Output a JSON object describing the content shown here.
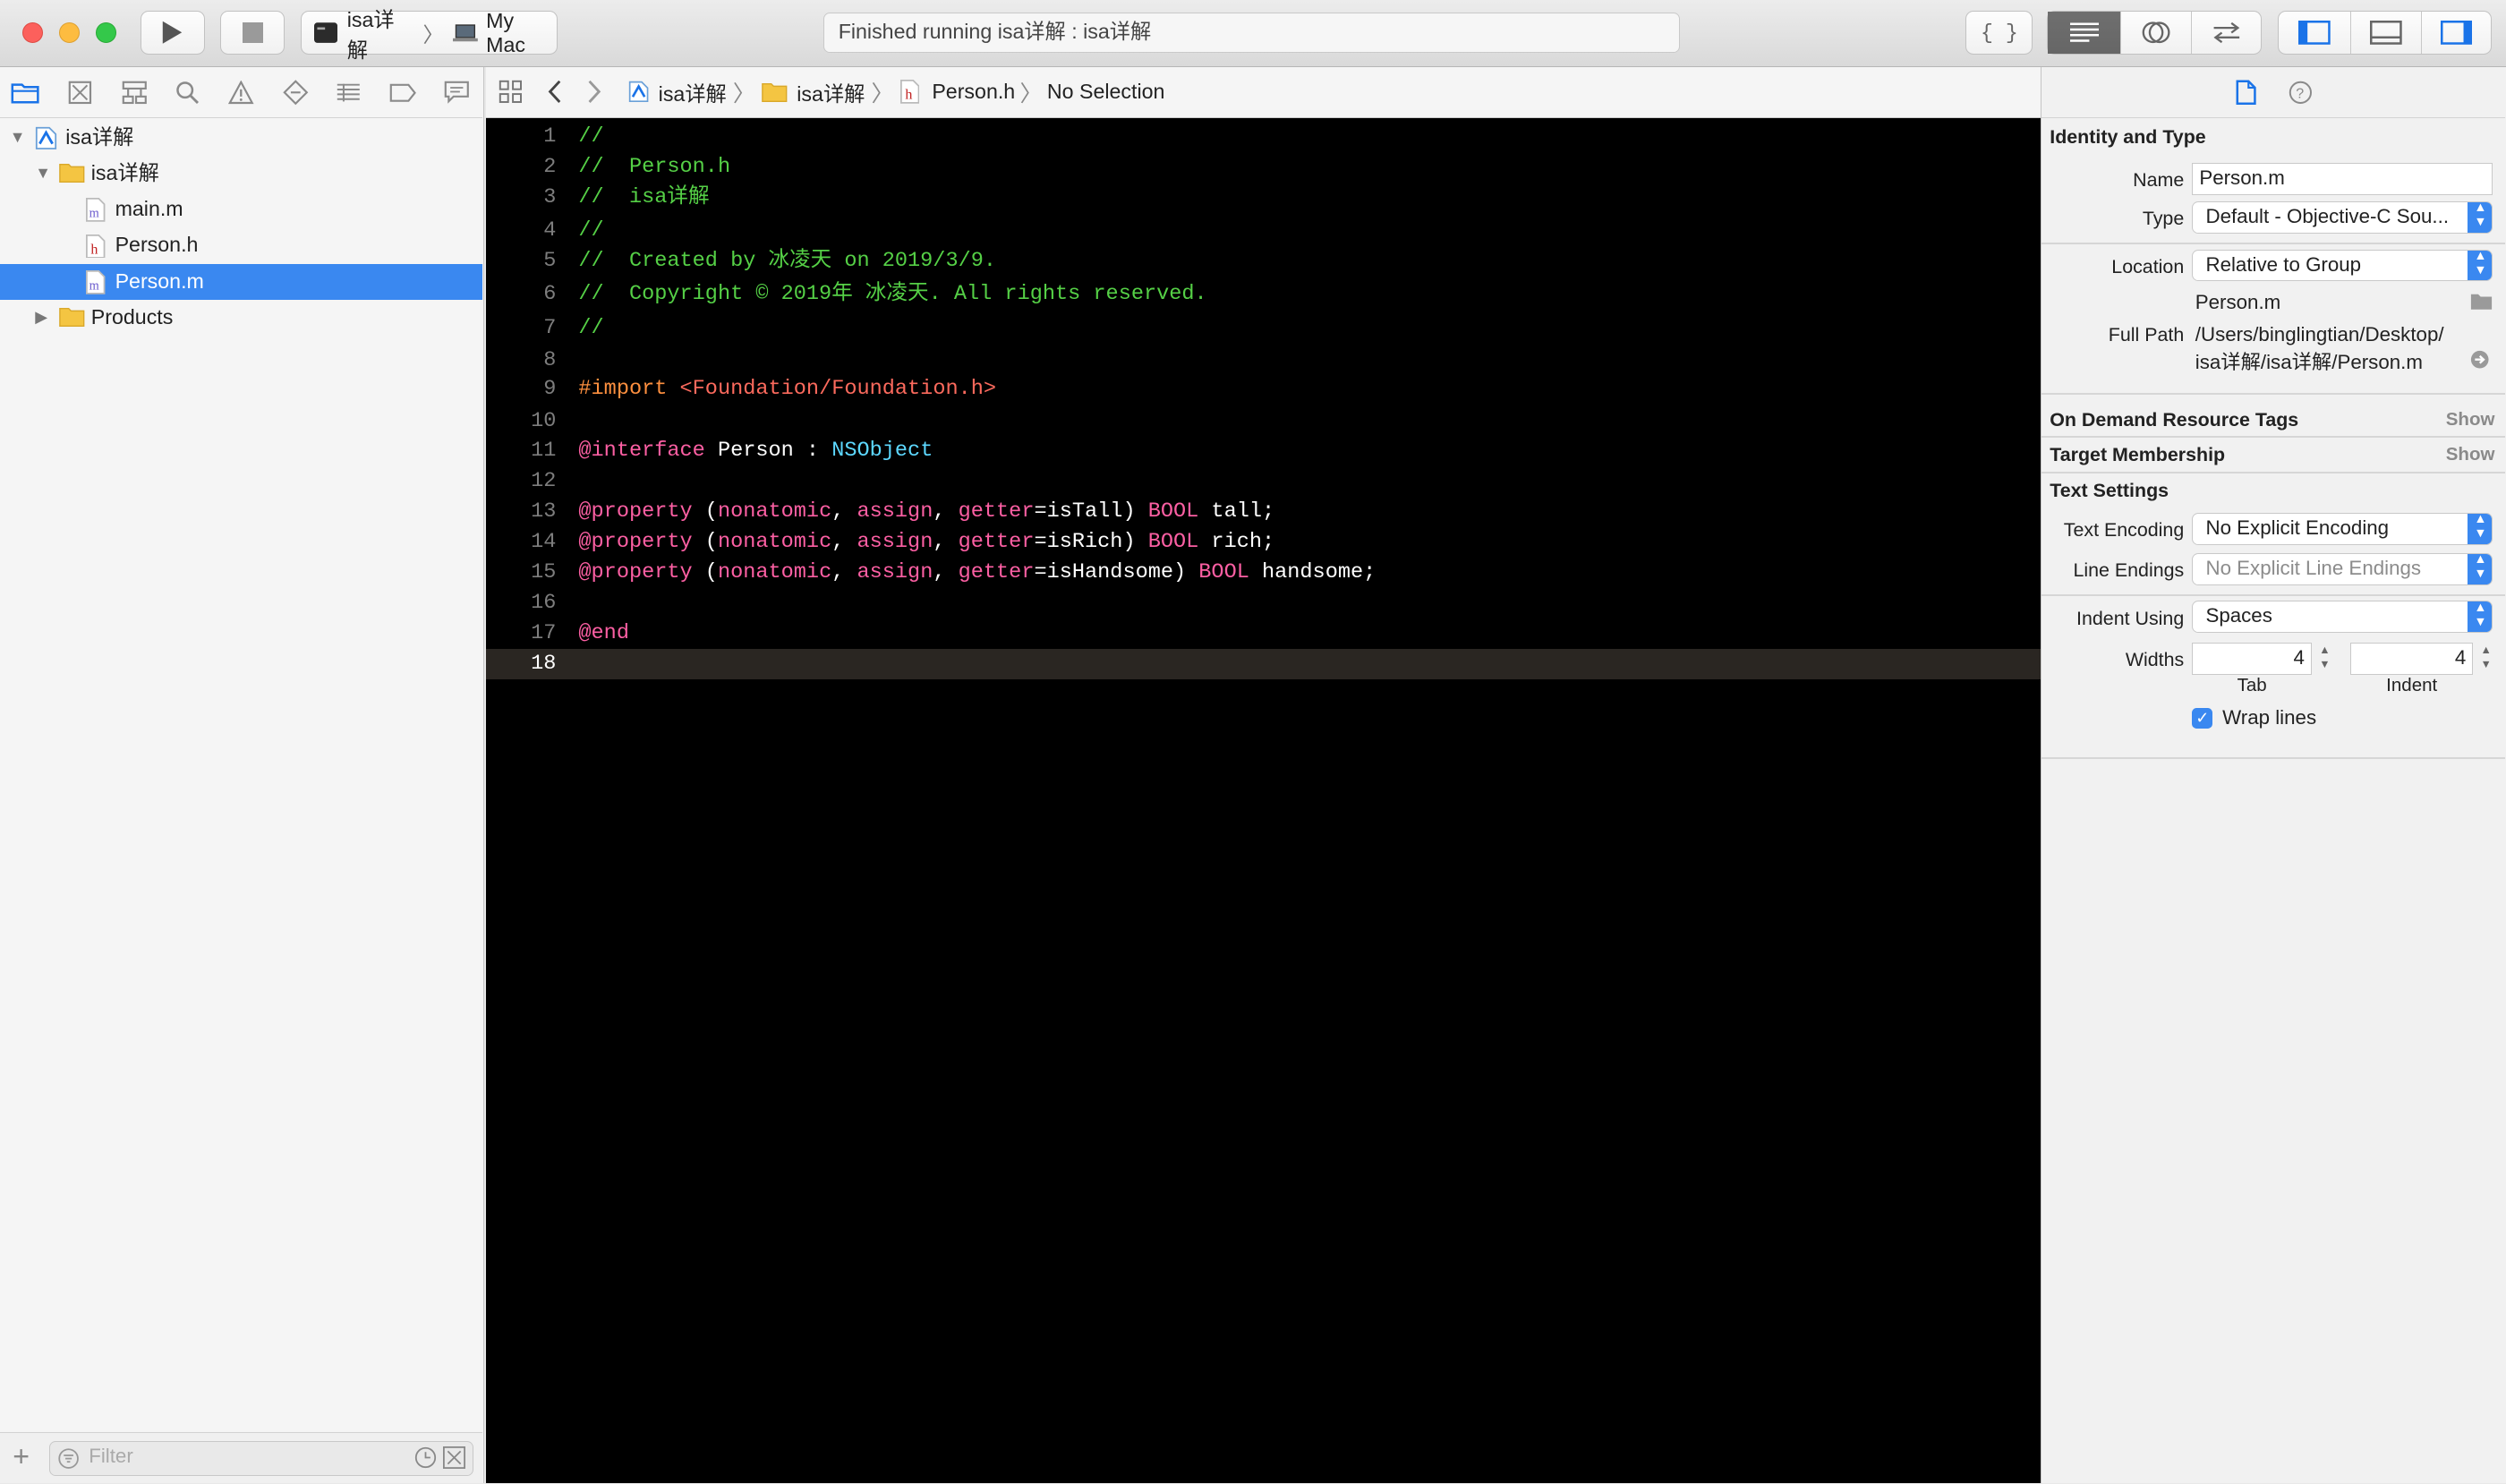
{
  "toolbar": {
    "scheme_target": "isa详解",
    "scheme_device": "My Mac",
    "status": "Finished running isa详解 : isa详解",
    "braces_label": "{ }"
  },
  "navigator": {
    "tree": [
      {
        "label": "isa详解",
        "kind": "project",
        "disclosure": "▼"
      },
      {
        "label": "isa详解",
        "kind": "folder",
        "disclosure": "▼"
      },
      {
        "label": "main.m",
        "kind": "m-file"
      },
      {
        "label": "Person.h",
        "kind": "h-file"
      },
      {
        "label": "Person.m",
        "kind": "m-file",
        "selected": true
      },
      {
        "label": "Products",
        "kind": "folder",
        "disclosure": "▶"
      }
    ],
    "filter_placeholder": "Filter"
  },
  "jumpbar": {
    "crumbs": [
      "isa详解",
      "isa详解",
      "Person.h",
      "No Selection"
    ]
  },
  "editor": {
    "current_line": 18,
    "lines": [
      {
        "n": "1",
        "tokens": [
          {
            "t": "//",
            "c": "com"
          }
        ]
      },
      {
        "n": "2",
        "tokens": [
          {
            "t": "//  Person.h",
            "c": "com"
          }
        ]
      },
      {
        "n": "3",
        "tokens": [
          {
            "t": "//  isa详解",
            "c": "com"
          }
        ]
      },
      {
        "n": "4",
        "tokens": [
          {
            "t": "//",
            "c": "com"
          }
        ]
      },
      {
        "n": "5",
        "tokens": [
          {
            "t": "//  Created by 冰凌天 on 2019/3/9.",
            "c": "com"
          }
        ]
      },
      {
        "n": "6",
        "tokens": [
          {
            "t": "//  Copyright © 2019年 冰凌天. All rights reserved.",
            "c": "com"
          }
        ]
      },
      {
        "n": "7",
        "tokens": [
          {
            "t": "//",
            "c": "com"
          }
        ]
      },
      {
        "n": "8",
        "tokens": []
      },
      {
        "n": "9",
        "tokens": [
          {
            "t": "#import ",
            "c": "pre"
          },
          {
            "t": "<Foundation/Foundation.h>",
            "c": "str"
          }
        ]
      },
      {
        "n": "10",
        "tokens": []
      },
      {
        "n": "11",
        "tokens": [
          {
            "t": "@interface",
            "c": "kw"
          },
          {
            "t": " Person : ",
            "c": "plain"
          },
          {
            "t": "NSObject",
            "c": "type"
          }
        ]
      },
      {
        "n": "12",
        "tokens": []
      },
      {
        "n": "13",
        "tokens": [
          {
            "t": "@property",
            "c": "kw"
          },
          {
            "t": " (",
            "c": "plain"
          },
          {
            "t": "nonatomic",
            "c": "kw"
          },
          {
            "t": ", ",
            "c": "plain"
          },
          {
            "t": "assign",
            "c": "kw"
          },
          {
            "t": ", ",
            "c": "plain"
          },
          {
            "t": "getter",
            "c": "kw"
          },
          {
            "t": "=isTall) ",
            "c": "plain"
          },
          {
            "t": "BOOL",
            "c": "kw"
          },
          {
            "t": " tall;",
            "c": "plain"
          }
        ]
      },
      {
        "n": "14",
        "tokens": [
          {
            "t": "@property",
            "c": "kw"
          },
          {
            "t": " (",
            "c": "plain"
          },
          {
            "t": "nonatomic",
            "c": "kw"
          },
          {
            "t": ", ",
            "c": "plain"
          },
          {
            "t": "assign",
            "c": "kw"
          },
          {
            "t": ", ",
            "c": "plain"
          },
          {
            "t": "getter",
            "c": "kw"
          },
          {
            "t": "=isRich) ",
            "c": "plain"
          },
          {
            "t": "BOOL",
            "c": "kw"
          },
          {
            "t": " rich;",
            "c": "plain"
          }
        ]
      },
      {
        "n": "15",
        "tokens": [
          {
            "t": "@property",
            "c": "kw"
          },
          {
            "t": " (",
            "c": "plain"
          },
          {
            "t": "nonatomic",
            "c": "kw"
          },
          {
            "t": ", ",
            "c": "plain"
          },
          {
            "t": "assign",
            "c": "kw"
          },
          {
            "t": ", ",
            "c": "plain"
          },
          {
            "t": "getter",
            "c": "kw"
          },
          {
            "t": "=isHandsome) ",
            "c": "plain"
          },
          {
            "t": "BOOL",
            "c": "kw"
          },
          {
            "t": " handsome;",
            "c": "plain"
          }
        ]
      },
      {
        "n": "16",
        "tokens": []
      },
      {
        "n": "17",
        "tokens": [
          {
            "t": "@end",
            "c": "kw"
          }
        ]
      },
      {
        "n": "18",
        "tokens": []
      }
    ]
  },
  "inspector": {
    "identity_title": "Identity and Type",
    "name_label": "Name",
    "name_value": "Person.m",
    "type_label": "Type",
    "type_value": "Default - Objective-C Sou...",
    "location_label": "Location",
    "location_value": "Relative to Group",
    "location_file": "Person.m",
    "fullpath_label": "Full Path",
    "fullpath_line1": "/Users/binglingtian/Desktop/",
    "fullpath_line2": "isa详解/isa详解/Person.m",
    "odr_title": "On Demand Resource Tags",
    "odr_show": "Show",
    "target_title": "Target Membership",
    "target_show": "Show",
    "text_title": "Text Settings",
    "encoding_label": "Text Encoding",
    "encoding_value": "No Explicit Encoding",
    "endings_label": "Line Endings",
    "endings_value": "No Explicit Line Endings",
    "indent_label": "Indent Using",
    "indent_value": "Spaces",
    "widths_label": "Widths",
    "tab_width": "4",
    "indent_width": "4",
    "tab_sub": "Tab",
    "indent_sub": "Indent",
    "wrap_label": "Wrap lines",
    "wrap_checked": true
  },
  "colors": {
    "comment": "#55d046",
    "keyword": "#fc5fa3",
    "preprocessor": "#fd8f3f",
    "string": "#fc6a5d",
    "type": "#5dd8ff",
    "selection": "#3a88f0",
    "editor_bg": "#000000"
  }
}
